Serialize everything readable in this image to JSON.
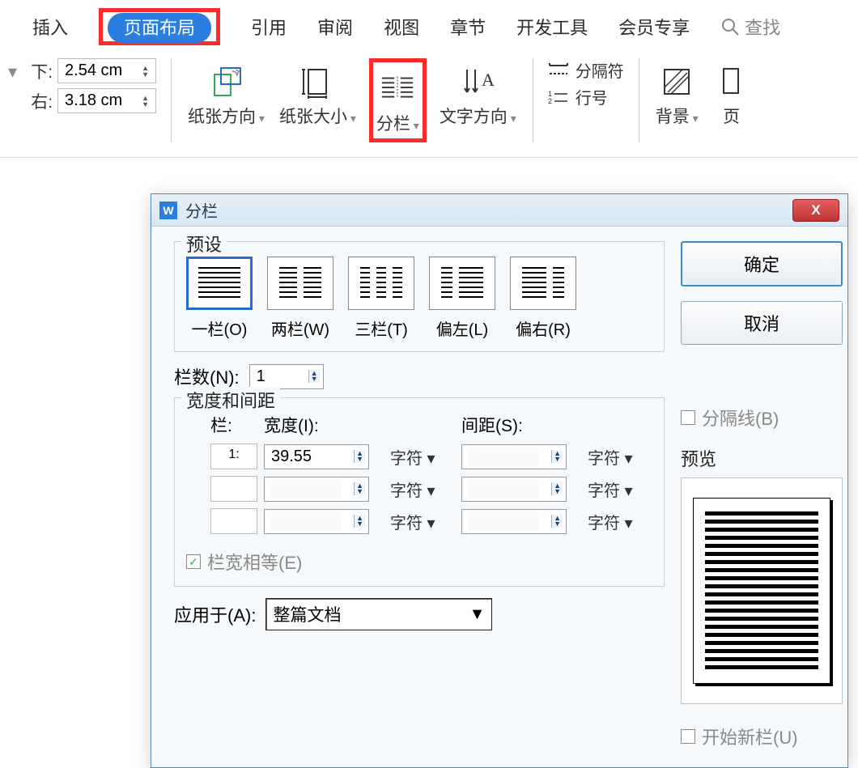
{
  "ribbon": {
    "tabs": {
      "insert": "插入",
      "page_layout": "页面布局",
      "references": "引用",
      "review": "审阅",
      "view": "视图",
      "sections": "章节",
      "developer": "开发工具",
      "member": "会员专享"
    },
    "search_label": "查找",
    "margins": {
      "bottom_label": "下:",
      "bottom_value": "2.54 cm",
      "right_label": "右:",
      "right_value": "3.18 cm"
    },
    "items": {
      "orientation": "纸张方向",
      "paper_size": "纸张大小",
      "columns": "分栏",
      "text_direction": "文字方向",
      "breaks": "分隔符",
      "line_numbers": "行号",
      "background": "背景",
      "page_extra": "页"
    }
  },
  "dialog": {
    "title": "分栏",
    "close_glyph": "X",
    "preset_label": "预设",
    "presets": {
      "one": "一栏(O)",
      "two": "两栏(W)",
      "three": "三栏(T)",
      "left": "偏左(L)",
      "right": "偏右(R)"
    },
    "num_cols_label": "栏数(N):",
    "num_cols_value": "1",
    "separator_label": "分隔线(B)",
    "width_spacing_label": "宽度和间距",
    "col_header": "栏:",
    "width_header": "宽度(I):",
    "spacing_header": "间距(S):",
    "row1_index": "1:",
    "row1_width": "39.55",
    "unit_label": "字符",
    "equal_width_label": "栏宽相等(E)",
    "preview_label": "预览",
    "apply_to_label": "应用于(A):",
    "apply_to_value": "整篇文档",
    "start_new_col_label": "开始新栏(U)",
    "ok_label": "确定",
    "cancel_label": "取消"
  }
}
